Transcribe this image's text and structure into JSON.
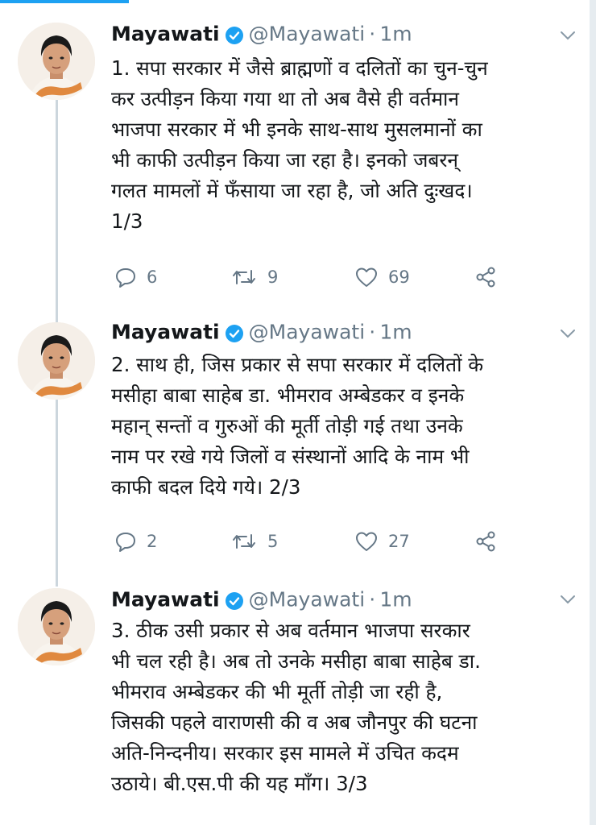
{
  "colors": {
    "accent": "#1da1f2",
    "text": "#14171a",
    "muted": "#657786",
    "border": "#ccd6dd"
  },
  "tweets": [
    {
      "name": "Mayawati",
      "handle": "@Mayawati",
      "separator": "·",
      "time": "1m",
      "text": "1. सपा सरकार में जैसे ब्राह्मणों व दलितों का चुन-चुन\nकर उत्पीड़न किया गया था तो अब वैसे ही वर्तमान\nभाजपा सरकार में भी इनके साथ-साथ मुसलमानों का\nभी काफी उत्पीड़न किया जा रहा है। इनको जबरन्\nगलत मामलों में फँसाया जा रहा है, जो अति दुःखद।\n1/3",
      "replies": "6",
      "retweets": "9",
      "likes": "69",
      "icons": {
        "reply": "reply-icon",
        "retweet": "retweet-icon",
        "like": "heart-icon",
        "share": "share-icon",
        "verified": "verified-badge-icon",
        "menu": "chevron-down-icon"
      }
    },
    {
      "name": "Mayawati",
      "handle": "@Mayawati",
      "separator": "·",
      "time": "1m",
      "text": "2. साथ ही, जिस प्रकार से सपा सरकार में दलितों के\nमसीहा बाबा साहेब डा. भीमराव अम्बेडकर व इनके\nमहान् सन्तों व गुरुओं की मूर्ती तोड़ी गई तथा उनके\nनाम पर रखे गये जिलों व संस्थानों आदि के नाम भी\nकाफी बदल दिये गये। 2/3",
      "replies": "2",
      "retweets": "5",
      "likes": "27"
    },
    {
      "name": "Mayawati",
      "handle": "@Mayawati",
      "separator": "·",
      "time": "1m",
      "text": "3. ठीक उसी प्रकार से अब वर्तमान भाजपा सरकार\nभी चल रही है। अब तो उनके मसीहा बाबा साहेब डा.\nभीमराव अम्बेडकर की भी मूर्ती तोड़ी जा रही है,\nजिसकी पहले वाराणसी की व अब जौनपुर की घटना\nअति-निन्दनीय। सरकार इस मामले में उचित कदम\nउठाये। बी.एस.पी की यह माँग। 3/3"
    }
  ]
}
